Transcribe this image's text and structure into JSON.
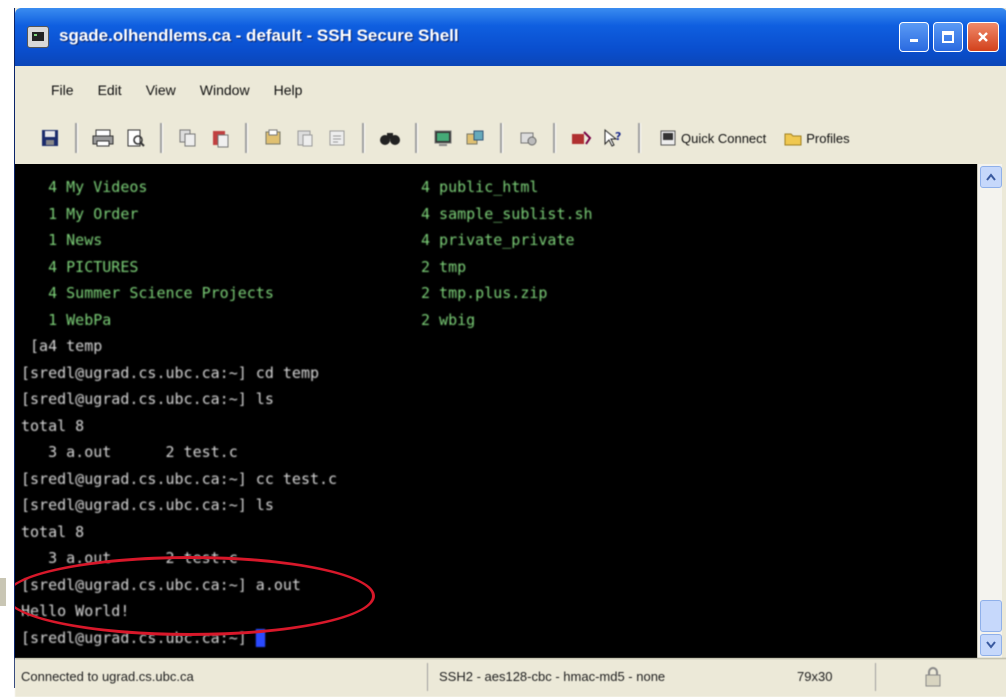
{
  "window": {
    "title": "sgade.olhendlems.ca - default - SSH Secure Shell",
    "controls": {
      "minimize": "minimize",
      "maximize": "maximize",
      "close": "close"
    }
  },
  "menu": [
    "File",
    "Edit",
    "View",
    "Window",
    "Help"
  ],
  "toolbar": {
    "icons": [
      "save-icon",
      "print-icon",
      "print-preview-icon",
      "copy-icon",
      "paste-icon",
      "paste-special-icon",
      "copy-file-icon",
      "paste-file-icon",
      "find-icon",
      "new-terminal-icon",
      "new-file-transfer-icon",
      "settings-icon",
      "profile-icon",
      "help-icon"
    ],
    "quick_connect_label": "Quick Connect",
    "profiles_label": "Profiles"
  },
  "terminal": {
    "lines": [
      {
        "left": "   4 My Videos",
        "right": "4 public_html"
      },
      {
        "left": "   1 My Order",
        "right": "4 sample_sublist.sh"
      },
      {
        "left": "   1 News",
        "right": "4 private_private"
      },
      {
        "left": "   4 PICTURES",
        "right": "2 tmp"
      },
      {
        "left": "   4 Summer Science Projects",
        "right": "2 tmp.plus.zip"
      },
      {
        "left": "   1 WebPa",
        "right": "2 wbig"
      },
      {
        "left": " [a4 temp",
        "right": ""
      },
      {
        "left": "[sredl@ugrad.cs.ubc.ca:~] cd temp",
        "right": ""
      },
      {
        "left": "[sredl@ugrad.cs.ubc.ca:~] ls",
        "right": ""
      },
      {
        "left": "total 8",
        "right": ""
      },
      {
        "left": "   3 a.out      2 test.c",
        "right": ""
      },
      {
        "left": "[sredl@ugrad.cs.ubc.ca:~] cc test.c",
        "right": ""
      },
      {
        "left": "[sredl@ugrad.cs.ubc.ca:~] ls",
        "right": ""
      },
      {
        "left": "total 8",
        "right": ""
      },
      {
        "left": "   3 a.out      2 test.c",
        "right": ""
      },
      {
        "left": "[sredl@ugrad.cs.ubc.ca:~] a.out",
        "right": ""
      },
      {
        "left": "Hello World!",
        "right": ""
      },
      {
        "left": "[sredl@ugrad.cs.ubc.ca:~] ",
        "right": ""
      }
    ]
  },
  "status": {
    "left": "Connected to ugrad.cs.ubc.ca",
    "middle": "SSH2 - aes128-cbc - hmac-md5 - none",
    "size": "79x30"
  },
  "colors": {
    "terminal_bg": "#000000",
    "prompt_text": "#d8d8d8",
    "listing_text": "#7ed37a",
    "highlight_ring": "#d8182a",
    "cursor": "#2a4aff"
  }
}
